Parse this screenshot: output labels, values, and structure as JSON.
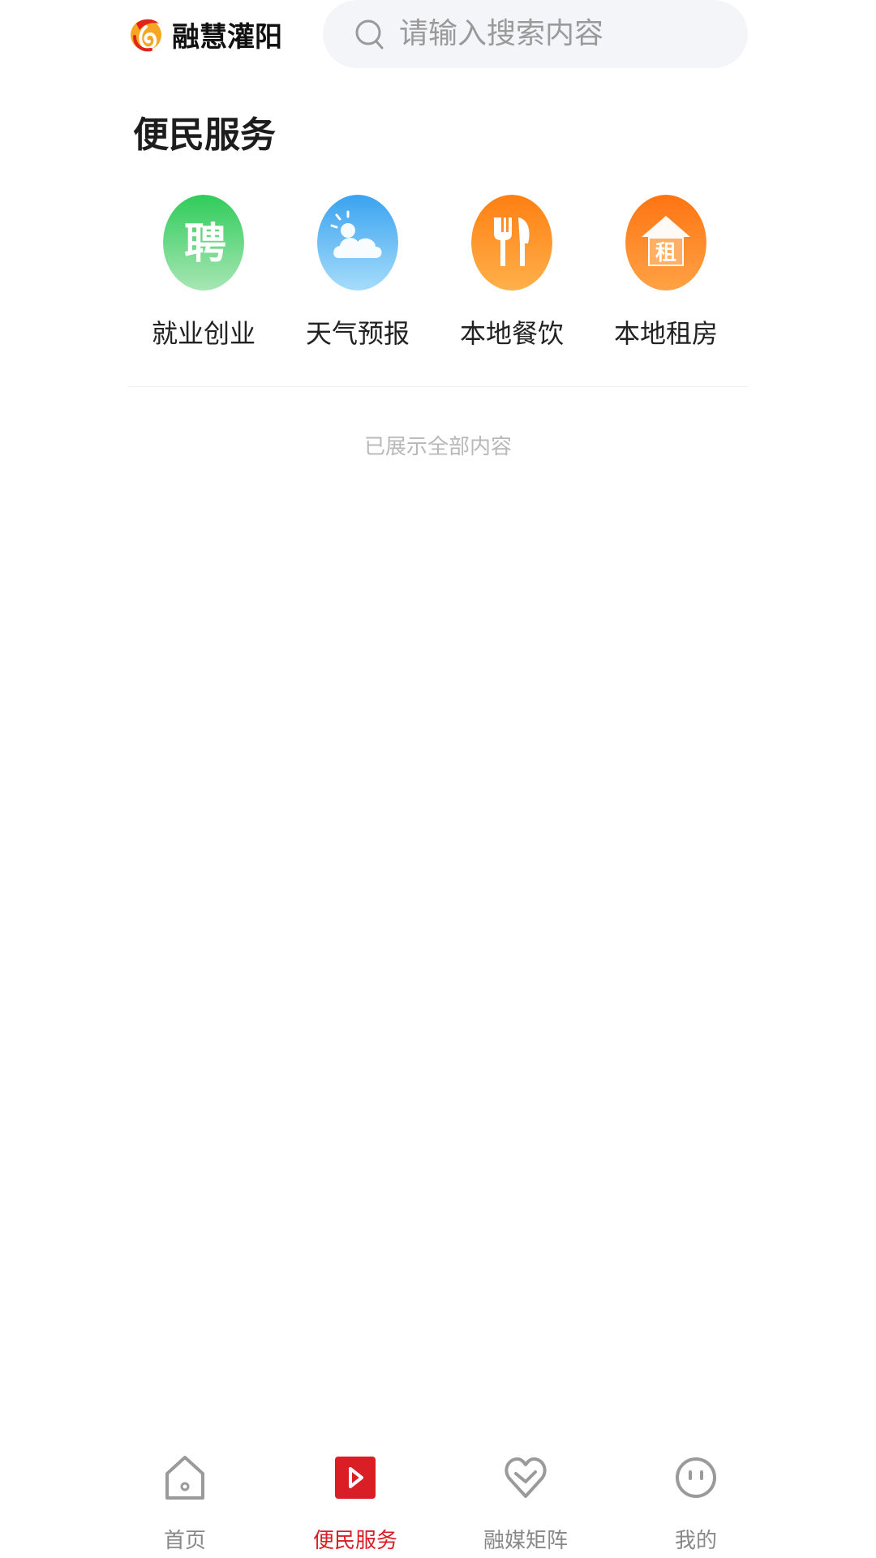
{
  "app": {
    "name": "融慧灌阳"
  },
  "search": {
    "placeholder": "请输入搜索内容"
  },
  "section": {
    "title": "便民服务"
  },
  "services": [
    {
      "label": "就业创业",
      "icon": "recruit-icon",
      "glyph": "聘",
      "color": "#3fcf6a"
    },
    {
      "label": "天气预报",
      "icon": "weather-icon",
      "color": "#55b5f3"
    },
    {
      "label": "本地餐饮",
      "icon": "dining-icon",
      "color": "#ff8a1e"
    },
    {
      "label": "本地租房",
      "icon": "rent-house-icon",
      "glyph": "租",
      "color": "#ff7a1b"
    }
  ],
  "list": {
    "end_text": "已展示全部内容"
  },
  "tabbar": {
    "tabs": [
      {
        "label": "首页",
        "icon": "home-icon",
        "active": false
      },
      {
        "label": "便民服务",
        "icon": "play-icon",
        "active": true
      },
      {
        "label": "融媒矩阵",
        "icon": "heart-icon",
        "active": false
      },
      {
        "label": "我的",
        "icon": "profile-face-icon",
        "active": false
      }
    ]
  },
  "colors": {
    "accent": "#d91e26",
    "inactive_tab": "#888888",
    "search_bg": "#f4f5f9"
  }
}
